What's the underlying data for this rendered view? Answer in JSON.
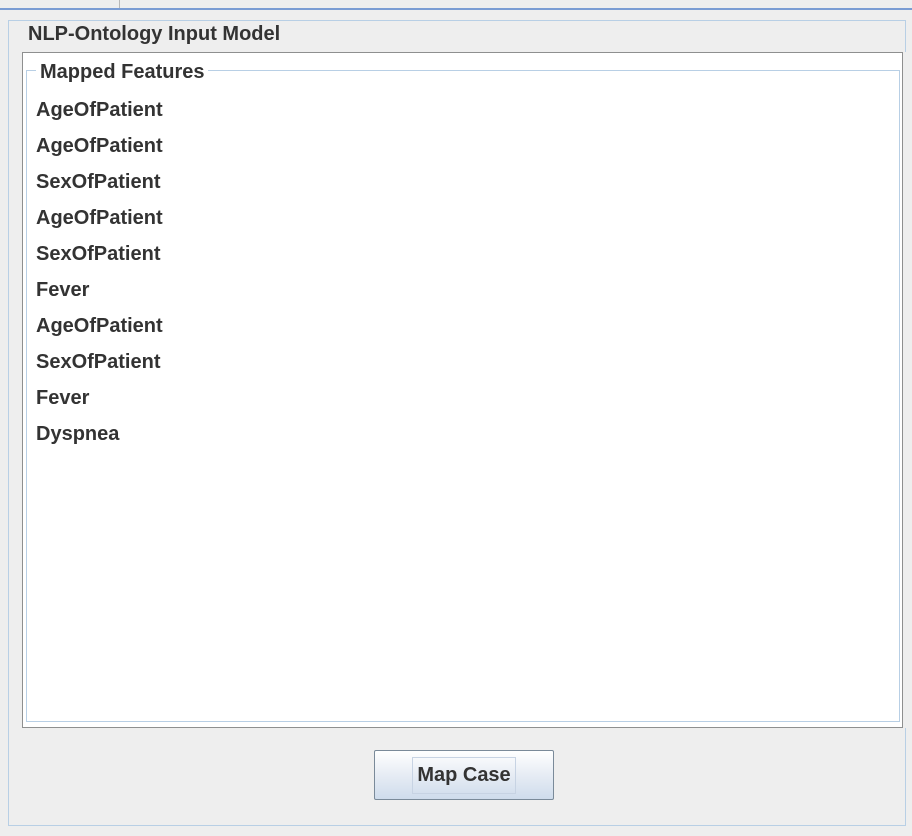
{
  "panel": {
    "title": "NLP-Ontology Input Model"
  },
  "mapped_features": {
    "title": "Mapped Features",
    "items": [
      "AgeOfPatient",
      "AgeOfPatient",
      "SexOfPatient",
      "AgeOfPatient",
      "SexOfPatient",
      "Fever",
      "AgeOfPatient",
      "SexOfPatient",
      "Fever",
      "Dyspnea"
    ]
  },
  "actions": {
    "map_case_label": "Map Case"
  }
}
